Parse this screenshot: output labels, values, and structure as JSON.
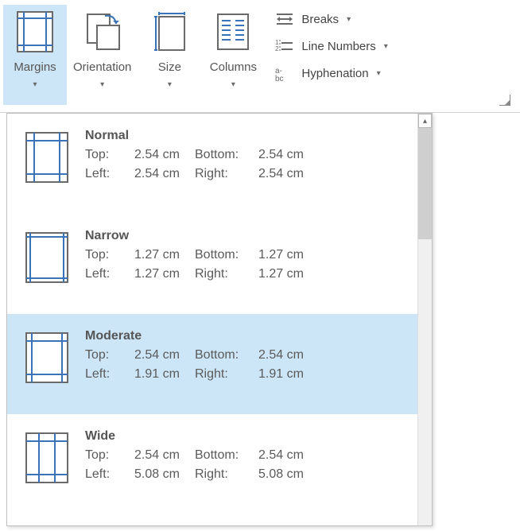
{
  "ribbon": {
    "margins": {
      "label": "Margins"
    },
    "orientation": {
      "label": "Orientation"
    },
    "size": {
      "label": "Size"
    },
    "columns": {
      "label": "Columns"
    },
    "breaks": {
      "label": "Breaks"
    },
    "line_numbers": {
      "label": "Line Numbers"
    },
    "hyphenation": {
      "label": "Hyphenation"
    }
  },
  "margins_gallery": {
    "items": [
      {
        "name": "Normal",
        "top_label": "Top:",
        "top_val": "2.54 cm",
        "bottom_label": "Bottom:",
        "bottom_val": "2.54 cm",
        "left_label": "Left:",
        "left_val": "2.54 cm",
        "right_label": "Right:",
        "right_val": "2.54 cm",
        "selected": false
      },
      {
        "name": "Narrow",
        "top_label": "Top:",
        "top_val": "1.27 cm",
        "bottom_label": "Bottom:",
        "bottom_val": "1.27 cm",
        "left_label": "Left:",
        "left_val": "1.27 cm",
        "right_label": "Right:",
        "right_val": "1.27 cm",
        "selected": false
      },
      {
        "name": "Moderate",
        "top_label": "Top:",
        "top_val": "2.54 cm",
        "bottom_label": "Bottom:",
        "bottom_val": "2.54 cm",
        "left_label": "Left:",
        "left_val": "1.91 cm",
        "right_label": "Right:",
        "right_val": "1.91 cm",
        "selected": true
      },
      {
        "name": "Wide",
        "top_label": "Top:",
        "top_val": "2.54 cm",
        "bottom_label": "Bottom:",
        "bottom_val": "2.54 cm",
        "left_label": "Left:",
        "left_val": "5.08 cm",
        "right_label": "Right:",
        "right_val": "5.08 cm",
        "selected": false
      }
    ]
  }
}
